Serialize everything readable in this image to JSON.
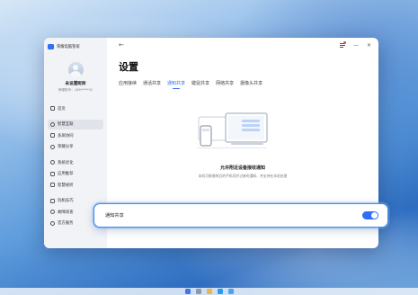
{
  "app": {
    "title": "荣耀电脑管家"
  },
  "user": {
    "name": "未设置昵称",
    "account": "荣耀账号：186*****02"
  },
  "sidebar": {
    "items": [
      {
        "label": "首页",
        "icon": "home-icon",
        "active": false
      },
      {
        "label": "智慧互联",
        "icon": "link-icon",
        "active": true
      },
      {
        "label": "多屏协同",
        "icon": "multiscreen-icon",
        "active": false
      },
      {
        "label": "荣耀分享",
        "icon": "share-icon",
        "active": false
      },
      {
        "label": "系统优化",
        "icon": "optimize-icon",
        "active": false
      },
      {
        "label": "应用推荐",
        "icon": "apps-icon",
        "active": false
      },
      {
        "label": "智慧视听",
        "icon": "av-icon",
        "active": false
      },
      {
        "label": "玩机技巧",
        "icon": "tips-icon",
        "active": false
      },
      {
        "label": "故障排查",
        "icon": "troubleshoot-icon",
        "active": false
      },
      {
        "label": "官方服务",
        "icon": "service-icon",
        "active": false
      }
    ]
  },
  "main": {
    "title": "设置",
    "tabs": [
      {
        "label": "应用接续",
        "active": false
      },
      {
        "label": "通话共享",
        "active": false
      },
      {
        "label": "通知共享",
        "active": true
      },
      {
        "label": "键鼠共享",
        "active": false
      },
      {
        "label": "网络共享",
        "active": false
      },
      {
        "label": "摄像头共享",
        "active": false
      }
    ],
    "empty_title": "允许附近设备接收通知",
    "empty_desc": "本机可接收附近的手机同步过来的通知，并支持在本机处理"
  },
  "toggle": {
    "label": "通知共享",
    "enabled": true
  },
  "colors": {
    "accent": "#2f6ef5",
    "active_nav_bg": "#e0e4ea",
    "sidebar_bg": "#f1f3f6"
  }
}
